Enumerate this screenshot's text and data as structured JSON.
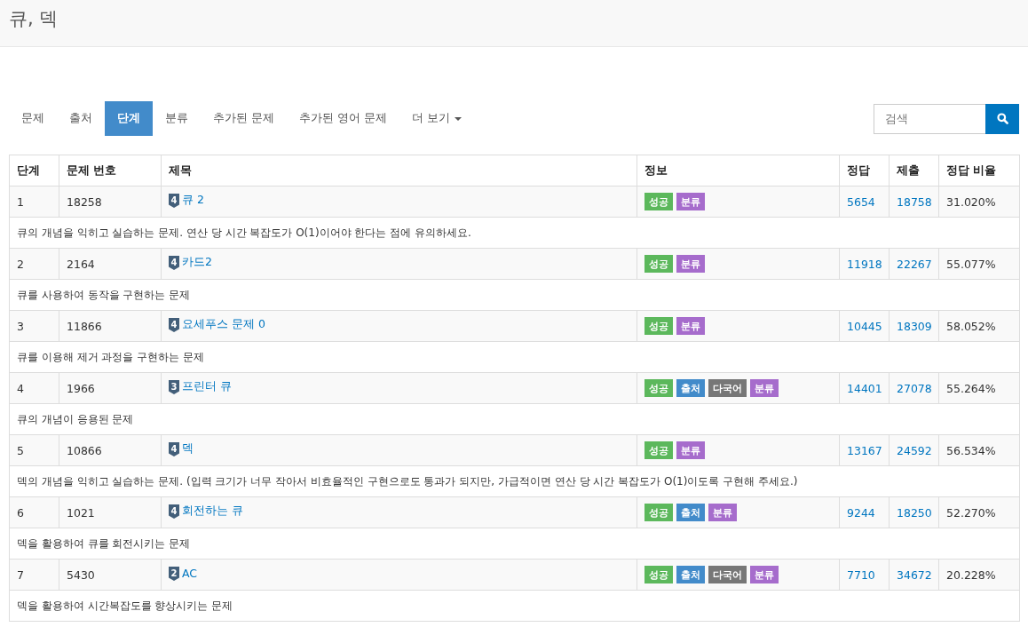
{
  "page_title": "큐, 덱",
  "tabs": [
    {
      "label": "문제",
      "selected": false
    },
    {
      "label": "출처",
      "selected": false
    },
    {
      "label": "단계",
      "selected": true
    },
    {
      "label": "분류",
      "selected": false
    },
    {
      "label": "추가된 문제",
      "selected": false
    },
    {
      "label": "추가된 영어 문제",
      "selected": false
    },
    {
      "label": "더 보기",
      "selected": false,
      "kind": "dropdown"
    }
  ],
  "search": {
    "placeholder": "검색"
  },
  "table": {
    "columns": [
      "단계",
      "문제 번호",
      "제목",
      "정보",
      "정답",
      "제출",
      "정답 비율"
    ],
    "rows": [
      {
        "step": "1",
        "number": "18258",
        "tier": "4",
        "title": "큐 2",
        "badges": [
          {
            "kind": "success",
            "label": "성공"
          },
          {
            "kind": "tag",
            "label": "분류"
          }
        ],
        "correct": "5654",
        "submissions": "18758",
        "ratio": "31.020%",
        "description": "큐의 개념을 익히고 실습하는 문제. 연산 당 시간 복잡도가 O(1)이어야 한다는 점에 유의하세요."
      },
      {
        "step": "2",
        "number": "2164",
        "tier": "4",
        "title": "카드2",
        "badges": [
          {
            "kind": "success",
            "label": "성공"
          },
          {
            "kind": "tag",
            "label": "분류"
          }
        ],
        "correct": "11918",
        "submissions": "22267",
        "ratio": "55.077%",
        "description": "큐를 사용하여 동작을 구현하는 문제"
      },
      {
        "step": "3",
        "number": "11866",
        "tier": "4",
        "title": "요세푸스 문제 0",
        "badges": [
          {
            "kind": "success",
            "label": "성공"
          },
          {
            "kind": "tag",
            "label": "분류"
          }
        ],
        "correct": "10445",
        "submissions": "18309",
        "ratio": "58.052%",
        "description": "큐를 이용해 제거 과정을 구현하는 문제"
      },
      {
        "step": "4",
        "number": "1966",
        "tier": "3",
        "title": "프린터 큐",
        "badges": [
          {
            "kind": "success",
            "label": "성공"
          },
          {
            "kind": "source",
            "label": "출처"
          },
          {
            "kind": "multilang",
            "label": "다국어"
          },
          {
            "kind": "tag",
            "label": "분류"
          }
        ],
        "correct": "14401",
        "submissions": "27078",
        "ratio": "55.264%",
        "description": "큐의 개념이 응용된 문제"
      },
      {
        "step": "5",
        "number": "10866",
        "tier": "4",
        "title": "덱",
        "badges": [
          {
            "kind": "success",
            "label": "성공"
          },
          {
            "kind": "tag",
            "label": "분류"
          }
        ],
        "correct": "13167",
        "submissions": "24592",
        "ratio": "56.534%",
        "description": "덱의 개념을 익히고 실습하는 문제. (입력 크기가 너무 작아서 비효율적인 구현으로도 통과가 되지만, 가급적이면 연산 당 시간 복잡도가 O(1)이도록 구현해 주세요.)"
      },
      {
        "step": "6",
        "number": "1021",
        "tier": "4",
        "title": "회전하는 큐",
        "badges": [
          {
            "kind": "success",
            "label": "성공"
          },
          {
            "kind": "source",
            "label": "출처"
          },
          {
            "kind": "tag",
            "label": "분류"
          }
        ],
        "correct": "9244",
        "submissions": "18250",
        "ratio": "52.270%",
        "description": "덱을 활용하여 큐를 회전시키는 문제"
      },
      {
        "step": "7",
        "number": "5430",
        "tier": "2",
        "title": "AC",
        "badges": [
          {
            "kind": "success",
            "label": "성공"
          },
          {
            "kind": "source",
            "label": "출처"
          },
          {
            "kind": "multilang",
            "label": "다국어"
          },
          {
            "kind": "tag",
            "label": "분류"
          }
        ],
        "correct": "7710",
        "submissions": "34672",
        "ratio": "20.228%",
        "description": "덱을 활용하여 시간복잡도를 향상시키는 문제"
      }
    ]
  }
}
